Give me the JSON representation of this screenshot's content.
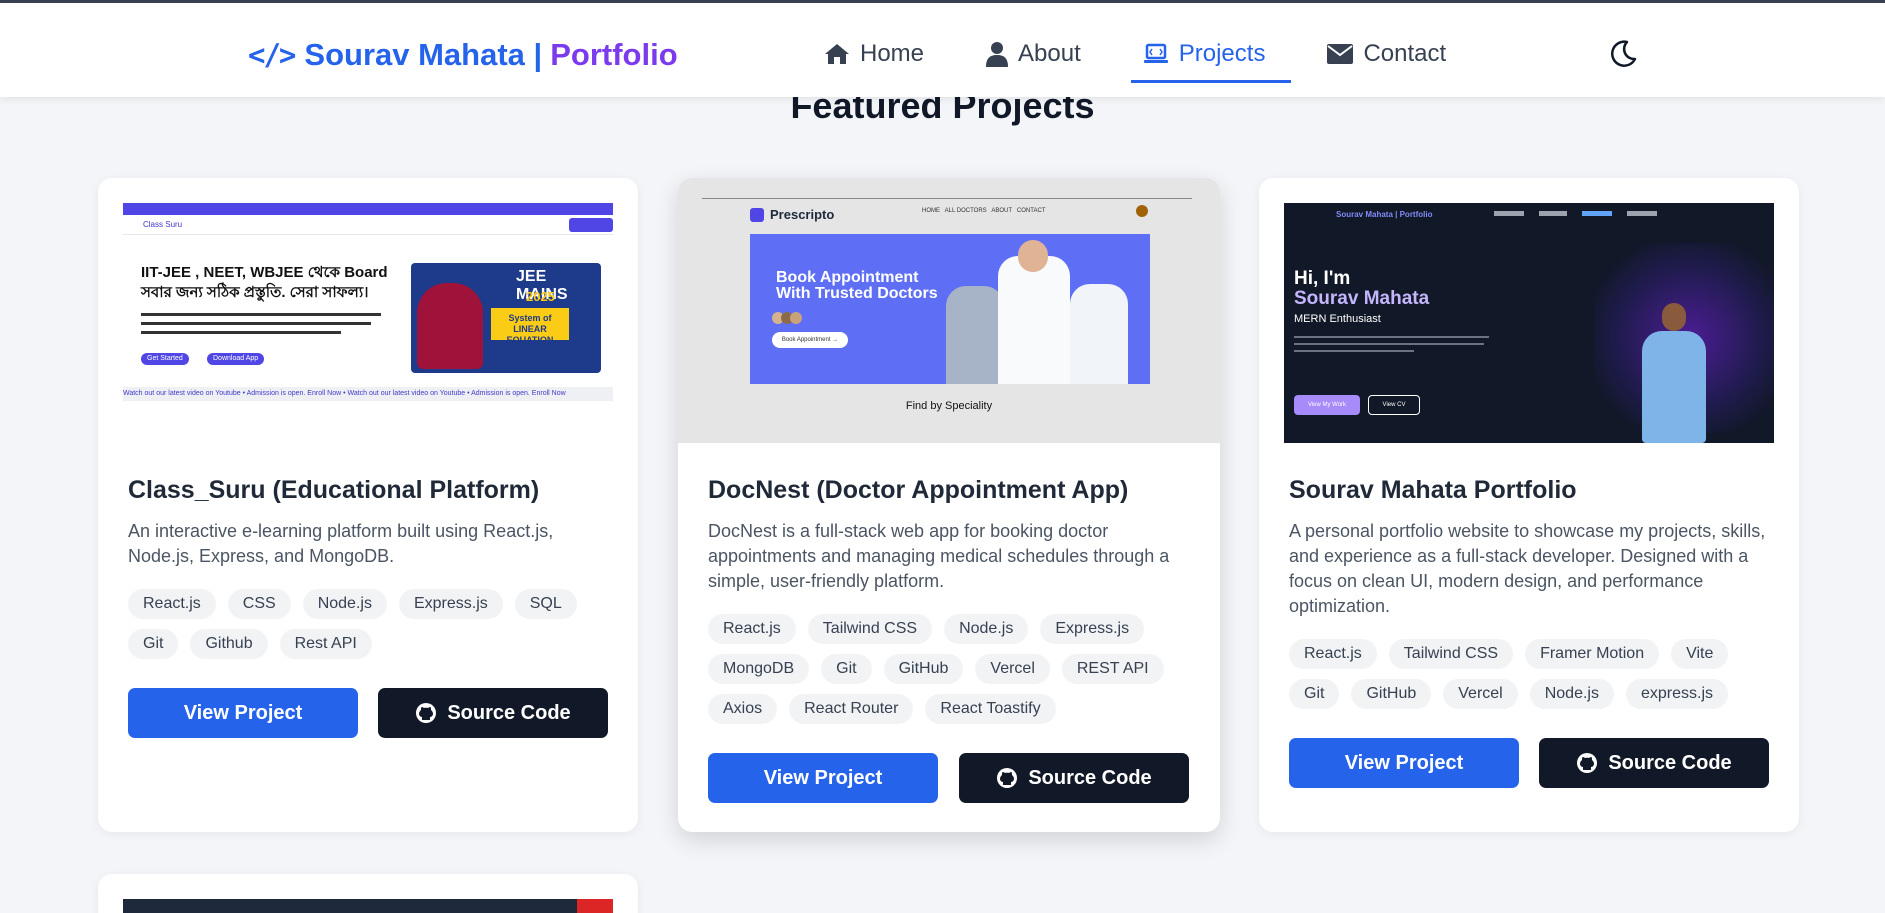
{
  "header": {
    "logo_icon": "code-icon",
    "logo_text_1": "Sourav Mahata |",
    "logo_text_2": "Portfolio",
    "nav": [
      {
        "label": "Home",
        "icon": "home-icon"
      },
      {
        "label": "About",
        "icon": "user-icon"
      },
      {
        "label": "Projects",
        "icon": "laptop-icon",
        "active": true
      },
      {
        "label": "Contact",
        "icon": "envelope-icon"
      }
    ],
    "theme_toggle_icon": "moon-icon"
  },
  "section_title": "Featured Projects",
  "projects": [
    {
      "title": "Class_Suru (Educational Platform)",
      "description": "An interactive e-learning platform built using React.js, Node.js, Express, and MongoDB.",
      "tags": [
        "React.js",
        "CSS",
        "Node.js",
        "Express.js",
        "SQL",
        "Git",
        "Github",
        "Rest API"
      ],
      "view_label": "View Project",
      "source_label": "Source Code",
      "preview": {
        "site_name": "Class Suru",
        "headline": "IIT-JEE , NEET, WBJEE থেকে Board সবার জন্য সঠিক প্রস্তুতি. সেরা সাফল্য।",
        "poster_title": "JEE MAINS",
        "poster_year": "2025",
        "poster_topic": "System of LINEAR EQUATION",
        "button_1": "Get Started",
        "button_2": "Download App",
        "ticker": "Watch out our latest video on Youtube  •  Admission is open. Enroll Now  •  Watch out our latest video on Youtube  •  Admission is open. Enroll Now"
      }
    },
    {
      "title": "DocNest (Doctor Appointment App)",
      "description": "DocNest is a full-stack web app for booking doctor appointments and managing medical schedules through a simple, user-friendly platform.",
      "tags": [
        "React.js",
        "Tailwind CSS",
        "Node.js",
        "Express.js",
        "MongoDB",
        "Git",
        "GitHub",
        "Vercel",
        "REST API",
        "Axios",
        "React Router",
        "React Toastify"
      ],
      "view_label": "View Project",
      "source_label": "Source Code",
      "preview": {
        "site_name": "Prescripto",
        "nav": "HOME   ALL DOCTORS   ABOUT   CONTACT",
        "headline": "Book Appointment With Trusted Doctors",
        "button": "Book Appointment →",
        "section": "Find by Speciality"
      }
    },
    {
      "title": "Sourav Mahata Portfolio",
      "description": "A personal portfolio website to showcase my projects, skills, and experience as a full-stack developer. Designed with a focus on clean UI, modern design, and performance optimization.",
      "tags": [
        "React.js",
        "Tailwind CSS",
        "Framer Motion",
        "Vite",
        "Git",
        "GitHub",
        "Vercel",
        "Node.js",
        "express.js"
      ],
      "view_label": "View Project",
      "source_label": "Source Code",
      "preview": {
        "logo": "Sourav Mahata | Portfolio",
        "greeting": "Hi, I'm",
        "name": "Sourav Mahata",
        "role": "MERN Enthusiast",
        "button_1": "View My Work",
        "button_2": "View CV"
      }
    }
  ],
  "colors": {
    "accent": "#2563eb",
    "accent_purple": "#7c3aed",
    "dark_button": "#111827",
    "page_bg": "#f3f5f9"
  }
}
